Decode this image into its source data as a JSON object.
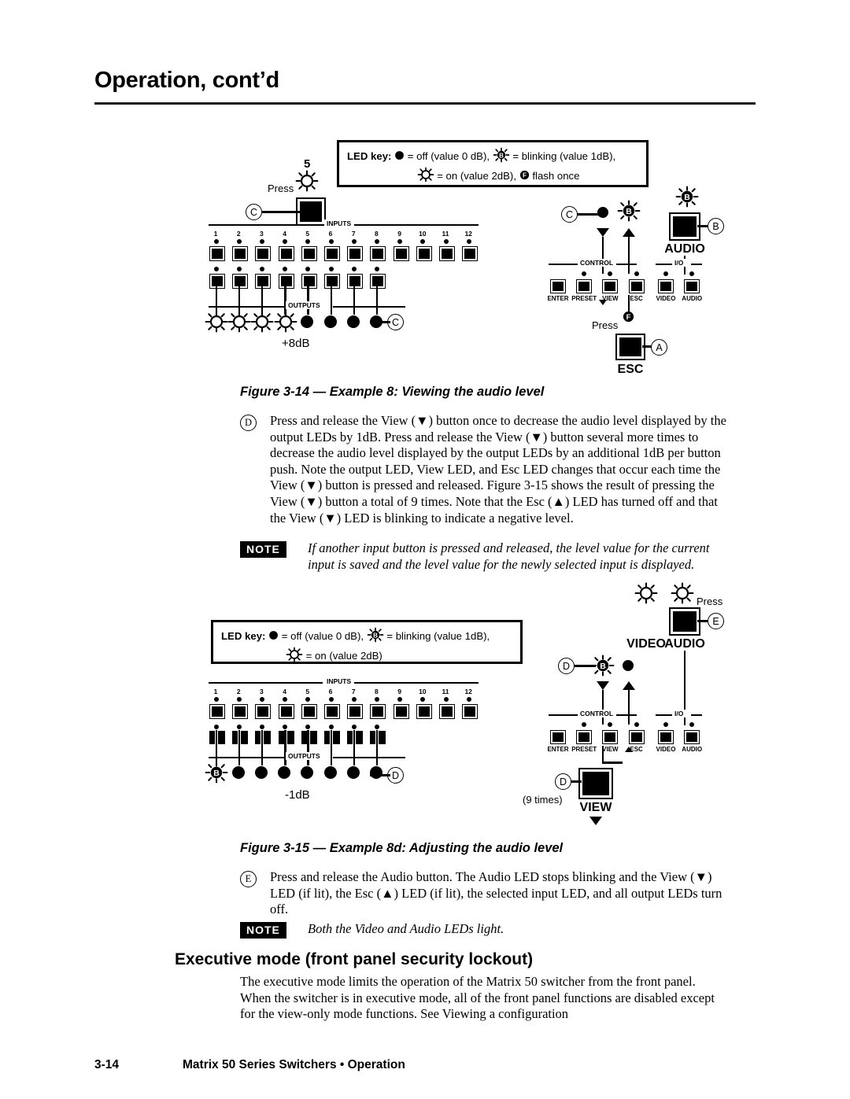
{
  "header": {
    "title": "Operation, cont’d"
  },
  "footer": {
    "page": "3-14",
    "text": "Matrix 50 Series Switchers • Operation"
  },
  "led_key_1": {
    "label": "LED key:",
    "line1_a": "= off (value 0 dB),",
    "line1_b": "= blinking (value 1dB),",
    "line2_a": "= on (value 2dB),",
    "line2_b": "flash once"
  },
  "led_key_2": {
    "label": "LED key:",
    "line1_a": "= off (value 0 dB),",
    "line1_b": "= blinking (value 1dB),",
    "line2_a": "= on (value 2dB)"
  },
  "figure1": {
    "caption": "Figure 3-14 — Example 8:  Viewing the audio level",
    "step_number": "5",
    "press_label": "Press",
    "db_value": "+8dB",
    "inputs_rail": "INPUTS",
    "outputs_rail": "OUTPUTS",
    "input_numbers": [
      "1",
      "2",
      "3",
      "4",
      "5",
      "6",
      "7",
      "8",
      "9",
      "10",
      "11",
      "12"
    ],
    "control_rail": "CONTROL",
    "io_rail": "I/O",
    "control_buttons": [
      "ENTER",
      "PRESET",
      "VIEW",
      "ESC"
    ],
    "io_buttons": [
      "VIDEO",
      "AUDIO"
    ],
    "audio_label": "AUDIO",
    "esc_label": "ESC",
    "press_label2": "Press",
    "callouts": {
      "a": "A",
      "b": "B",
      "c": "C",
      "f": "F"
    },
    "output_leds": [
      "on",
      "on",
      "on",
      "on",
      "off",
      "off",
      "off",
      "off"
    ],
    "view_led": "off",
    "esc_led": "blinking",
    "audio_led": "blinking"
  },
  "figure2": {
    "caption": "Figure 3-15 — Example 8d:  Adjusting the audio level",
    "db_value": "-1dB",
    "inputs_rail": "INPUTS",
    "outputs_rail": "OUTPUTS",
    "input_numbers": [
      "1",
      "2",
      "3",
      "4",
      "5",
      "6",
      "7",
      "8",
      "9",
      "10",
      "11",
      "12"
    ],
    "control_rail": "CONTROL",
    "io_rail": "I/O",
    "control_buttons": [
      "ENTER",
      "PRESET",
      "VIEW",
      "ESC"
    ],
    "io_buttons": [
      "VIDEO",
      "AUDIO"
    ],
    "video_label": "VIDEO",
    "audio_label": "AUDIO",
    "view_label": "VIEW",
    "press_label": "Press",
    "times_label": "(9 times)",
    "callouts": {
      "b": "B",
      "d": "D",
      "e": "E"
    },
    "output_leds": [
      "blinking",
      "off",
      "off",
      "off",
      "off",
      "off",
      "off",
      "off"
    ],
    "view_led": "blinking",
    "esc_led": "off",
    "video_led": "on",
    "audio_led": "on"
  },
  "steps": {
    "d_letter": "D",
    "d_text": "Press and release the View (▼) button once to decrease the audio level displayed by the output LEDs by 1dB.  Press and release the View (▼) button several more times to decrease the audio level displayed by the output LEDs by an additional 1dB per button push.  Note the output LED, View LED, and Esc LED changes that occur each time the View (▼) button is pressed and released.  Figure 3-15 shows the result of pressing the View (▼) button a total of 9 times.  Note that the Esc (▲) LED has turned off and that the View (▼) LED is blinking to indicate a negative level.",
    "e_letter": "E",
    "e_text": "Press and release the Audio button.  The Audio LED stops blinking and the View (▼) LED (if lit), the Esc (▲) LED (if lit), the selected input LED, and all output LEDs turn off."
  },
  "notes": {
    "badge": "NOTE",
    "note1": "If another input button is pressed and released, the level value for the current input is saved and the level value for the newly selected input is displayed.",
    "note2": "Both the Video and Audio LEDs light."
  },
  "section": {
    "heading": "Executive mode (front panel security lockout)",
    "paragraph": "The executive mode limits the operation of the Matrix 50 switcher from the front panel.  When the switcher is in executive mode, all of the front panel functions are disabled except for the view-only mode functions.  See Viewing a configuration"
  },
  "colors": {
    "ink": "#000000",
    "paper": "#ffffff"
  }
}
